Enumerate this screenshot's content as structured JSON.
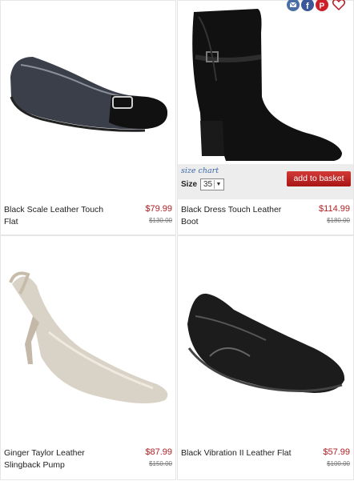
{
  "products": [
    {
      "name": "Black Scale Leather Touch Flat",
      "price": "$79.99",
      "was_price": "$130.00"
    },
    {
      "name": "Black Dress Touch Leather Boot",
      "price": "$114.99",
      "was_price": "$180.00"
    },
    {
      "name": "Ginger Taylor Leather Slingback Pump",
      "price": "$87.99",
      "was_price": "$150.00"
    },
    {
      "name": "Black Vibration II Leather Flat",
      "price": "$57.99",
      "was_price": "$100.00"
    }
  ],
  "quickview": {
    "size_chart_label": "size chart",
    "size_label": "Size",
    "size_value": "35",
    "add_to_basket_label": "add to basket"
  },
  "share_icons": [
    "email-icon",
    "facebook-icon",
    "pinterest-icon",
    "heart-icon"
  ],
  "colors": {
    "price": "#b01e23",
    "button": "#b51d1d",
    "link": "#3a66a8"
  }
}
